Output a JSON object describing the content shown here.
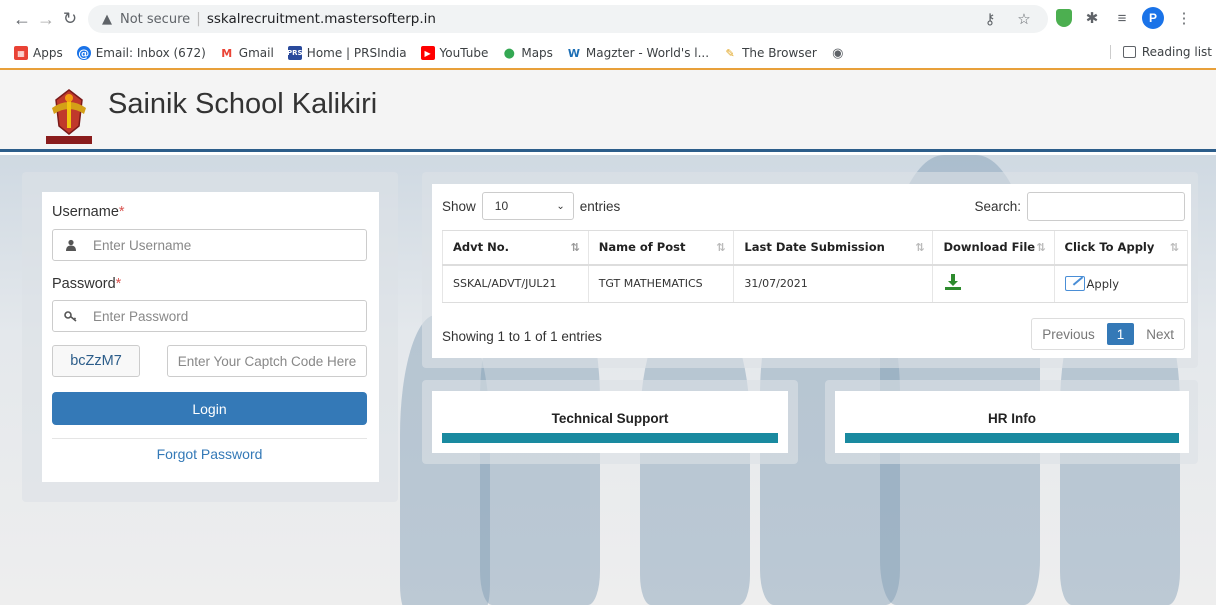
{
  "browser": {
    "security_label": "Not secure",
    "separator": "|",
    "url": "sskalrecruitment.mastersofterp.in",
    "profile_initial": "P",
    "bookmarks": [
      {
        "label": "Apps",
        "color": "#e94235"
      },
      {
        "label": "Email: Inbox (672)",
        "color": "#1a73e8"
      },
      {
        "label": "Gmail",
        "color": "#ea4335"
      },
      {
        "label": "Home | PRSIndia",
        "color": "#2a4a9c"
      },
      {
        "label": "YouTube",
        "color": "#ff0000"
      },
      {
        "label": "Maps",
        "color": "#34a853"
      },
      {
        "label": "Magzter - World's l...",
        "color": "#1d6fb5"
      },
      {
        "label": "The Browser",
        "color": "#e0a21a"
      },
      {
        "label": "",
        "color": "#5f6368"
      }
    ],
    "reading_list": "Reading list"
  },
  "header": {
    "title": "Sainik School Kalikiri"
  },
  "login": {
    "username_label": "Username",
    "username_placeholder": "Enter Username",
    "password_label": "Password",
    "password_placeholder": "Enter Password",
    "required_mark": "*",
    "captcha_code": "bcZzM7",
    "captcha_placeholder": "Enter Your Captch Code Here",
    "login_button": "Login",
    "forgot_password": "Forgot Password"
  },
  "datatable": {
    "show_label": "Show",
    "entries_label": "entries",
    "page_length": "10",
    "search_label": "Search:",
    "columns": [
      "Advt No.",
      "Name of Post",
      "Last Date Submission",
      "Download File",
      "Click To Apply"
    ],
    "rows": [
      {
        "advt_no": "SSKAL/ADVT/JUL21",
        "post": "TGT MATHEMATICS",
        "last_date": "31/07/2021",
        "apply": "Apply"
      }
    ],
    "info": "Showing 1 to 1 of 1 entries",
    "pager": {
      "previous": "Previous",
      "current": "1",
      "next": "Next"
    }
  },
  "panels": {
    "technical_support": "Technical Support",
    "hr_info": "HR Info"
  },
  "colors": {
    "primary": "#3479b7",
    "header_border": "#2c5d8a",
    "panel_bar": "#1a8aa0",
    "bookmark_underline": "#e8a03a"
  }
}
